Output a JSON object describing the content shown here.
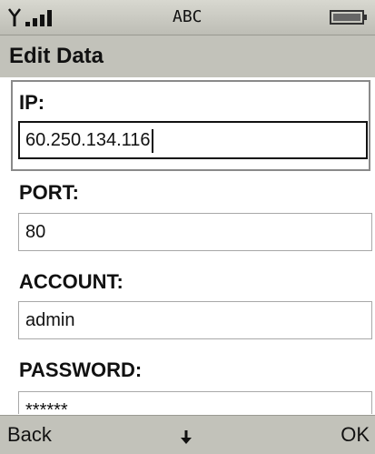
{
  "status": {
    "signal_icon": "antenna-signal-icon",
    "input_mode": "ABC",
    "battery_icon": "battery-icon"
  },
  "screen": {
    "title": "Edit Data"
  },
  "fields": [
    {
      "label": "IP:",
      "value": "60.250.134.116",
      "focused": true
    },
    {
      "label": "PORT:",
      "value": "80"
    },
    {
      "label": "ACCOUNT:",
      "value": "admin"
    },
    {
      "label": "PASSWORD:",
      "value": "******"
    }
  ],
  "softkeys": {
    "left": "Back",
    "center_icon": "down-arrow-icon",
    "right": "OK"
  }
}
